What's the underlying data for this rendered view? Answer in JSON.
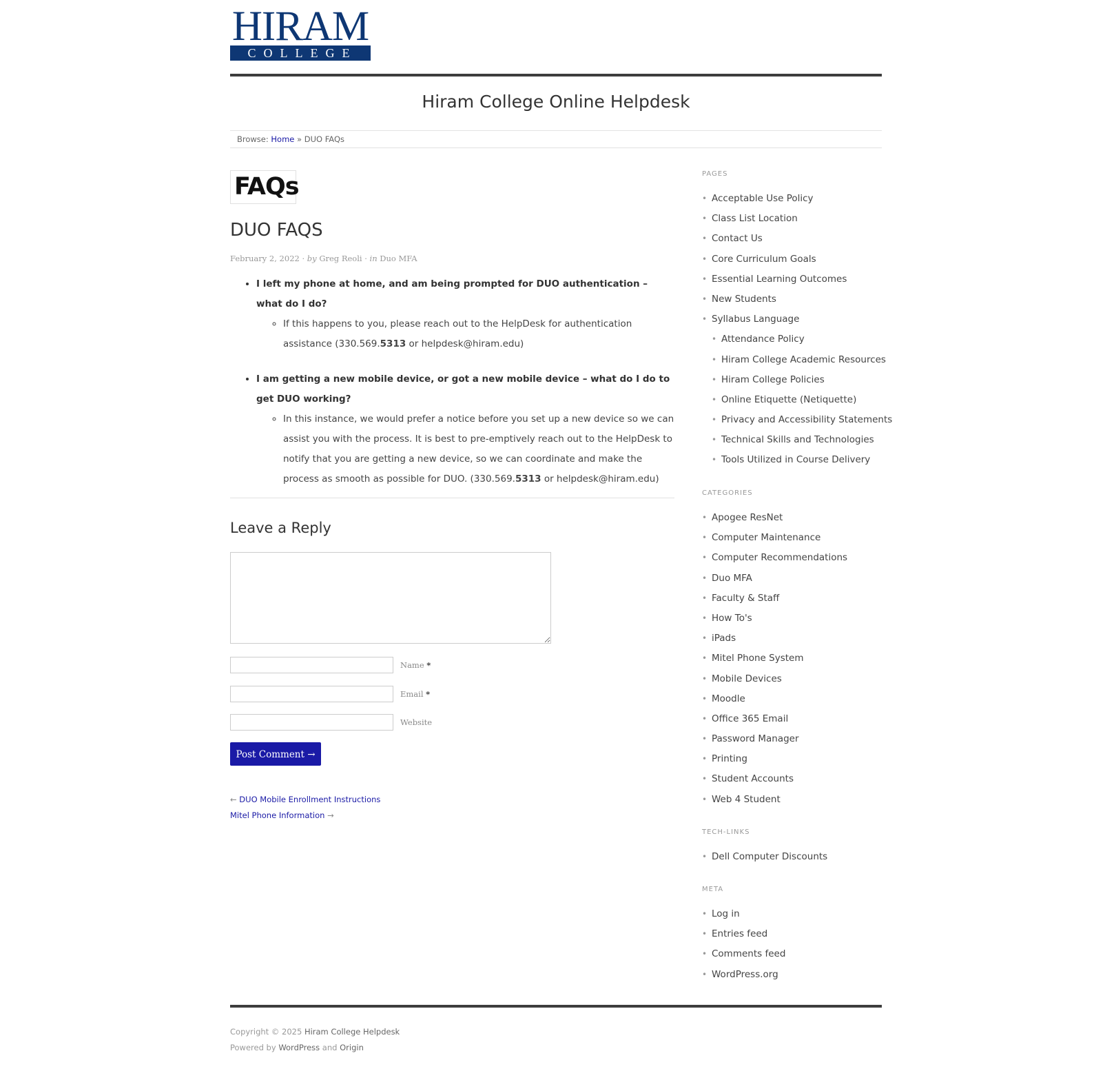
{
  "logo": {
    "top": "HIRAM",
    "bottom": "COLLEGE"
  },
  "site_title": "Hiram College Online Helpdesk",
  "breadcrumb": {
    "prefix": "Browse:",
    "home": "Home",
    "sep": "»",
    "current": "DUO FAQs"
  },
  "post": {
    "featured_text": "FAQs",
    "title": "DUO FAQS",
    "date": "February 2, 2022",
    "sep1": "·",
    "by": "by",
    "author": "Greg Reoli",
    "sep2": "·",
    "in": "in",
    "category": "Duo MFA",
    "faqs": [
      {
        "question": "I left my phone at home, and am being prompted for DUO authentication – what do I do?",
        "answer_pre": "If this happens to you, please reach out to the HelpDesk for authentication assistance (330.569.",
        "answer_bold": "5313",
        "answer_post": " or helpdesk@hiram.edu)"
      },
      {
        "question": "I am getting a new mobile device, or got a new mobile device – what do I do to get DUO working?",
        "answer_pre": "In this instance, we would prefer a notice before you set up a new device so we can assist you with the process. It is best to pre-emptively reach out to the HelpDesk to notify that you are getting a new device, so we can coordinate and make the process as smooth as possible for DUO. (330.569.",
        "answer_bold": "5313",
        "answer_post": " or helpdesk@hiram.edu)"
      }
    ]
  },
  "reply": {
    "title": "Leave a Reply",
    "name_label": "Name",
    "email_label": "Email",
    "website_label": "Website",
    "required_mark": "*",
    "submit": "Post Comment →"
  },
  "nav": {
    "prev_arrow": "←",
    "prev": "DUO Mobile Enrollment Instructions",
    "next": "Mitel Phone Information",
    "next_arrow": "→"
  },
  "sidebar": {
    "pages_title": "PAGES",
    "pages": [
      {
        "label": "Acceptable Use Policy",
        "sub": false
      },
      {
        "label": "Class List Location",
        "sub": false
      },
      {
        "label": "Contact Us",
        "sub": false
      },
      {
        "label": "Core Curriculum Goals",
        "sub": false
      },
      {
        "label": "Essential Learning Outcomes",
        "sub": false
      },
      {
        "label": "New Students",
        "sub": false
      },
      {
        "label": "Syllabus Language",
        "sub": false
      },
      {
        "label": "Attendance Policy",
        "sub": true
      },
      {
        "label": "Hiram College Academic Resources",
        "sub": true
      },
      {
        "label": "Hiram College Policies",
        "sub": true
      },
      {
        "label": "Online Etiquette (Netiquette)",
        "sub": true
      },
      {
        "label": "Privacy and Accessibility Statements",
        "sub": true
      },
      {
        "label": "Technical Skills and Technologies",
        "sub": true
      },
      {
        "label": "Tools Utilized in Course Delivery",
        "sub": true
      }
    ],
    "categories_title": "CATEGORIES",
    "categories": [
      "Apogee ResNet",
      "Computer Maintenance",
      "Computer Recommendations",
      "Duo MFA",
      "Faculty & Staff",
      "How To's",
      "iPads",
      "Mitel Phone System",
      "Mobile Devices",
      "Moodle",
      "Office 365 Email",
      "Password Manager",
      "Printing",
      "Student Accounts",
      "Web 4 Student"
    ],
    "techlinks_title": "TECH-LINKS",
    "techlinks": [
      "Dell Computer Discounts"
    ],
    "meta_title": "META",
    "meta": [
      "Log in",
      "Entries feed",
      "Comments feed",
      "WordPress.org"
    ]
  },
  "footer": {
    "copyright": "Copyright © 2025",
    "site": "Hiram College Helpdesk",
    "powered": "Powered by",
    "wp": "WordPress",
    "and": "and",
    "theme": "Origin"
  }
}
